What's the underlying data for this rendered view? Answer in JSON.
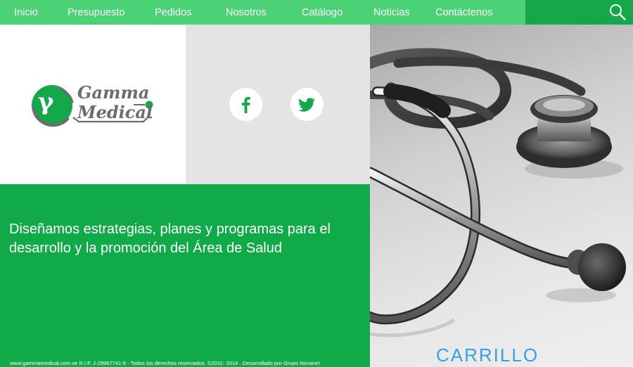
{
  "nav": {
    "items": [
      {
        "label": "Inicio"
      },
      {
        "label": "Presupuesto"
      },
      {
        "label": "Pedidos"
      },
      {
        "label": "Nosotros"
      },
      {
        "label": "Catálogo"
      },
      {
        "label": "Noticias"
      },
      {
        "label": "Contáctenos"
      }
    ],
    "search_icon": "search-icon",
    "color": "#4cd276",
    "search_bg": "#14a84a"
  },
  "logo": {
    "line1": "Gamma",
    "line2": "Medical",
    "symbol": "γ",
    "brand_green": "#14a84a",
    "brand_gray": "#6c6c6c"
  },
  "social": {
    "facebook_icon": "facebook-icon",
    "twitter_icon": "twitter-icon"
  },
  "hero": {
    "tagline": "Diseñamos estrategias, planes y programas para el desarrollo y la promoción del Área de Salud",
    "background": "#10ab48"
  },
  "footer": {
    "text": "www.gammamedical.com.ve R.I.F. J-29967741-8 - Todos los derechos reservados. ©2011- 2014 . Desarrollado por  Grupo Novanet"
  },
  "photo": {
    "subject": "stethoscope",
    "caption": "CARRILLO",
    "caption_color": "#3a9ee2"
  }
}
